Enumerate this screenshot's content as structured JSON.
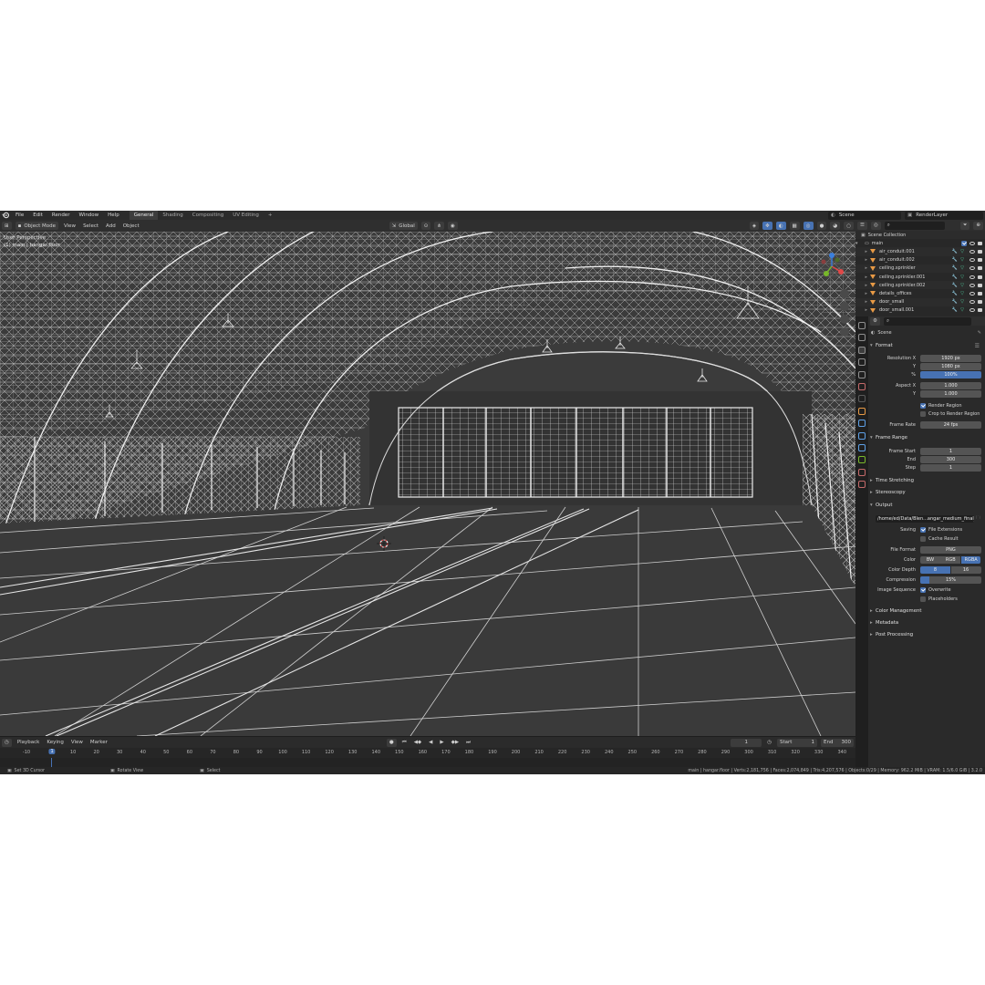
{
  "menu": {
    "items": [
      "File",
      "Edit",
      "Render",
      "Window",
      "Help"
    ],
    "workspaces": [
      "General",
      "Shading",
      "Compositing",
      "UV Editing"
    ],
    "active_workspace": "General",
    "add_tab": "+",
    "scene": "Scene",
    "view_layer": "RenderLayer"
  },
  "viewport_header": {
    "mode": "Object Mode",
    "view": "View",
    "select": "Select",
    "add": "Add",
    "object": "Object",
    "orientation": "Global"
  },
  "viewport": {
    "perspective_label": "User Perspective",
    "collection_label": "(1) main | hangar.floor"
  },
  "outliner": {
    "root": "Scene Collection",
    "collection": "main",
    "items": [
      "air_conduit.001",
      "air_conduit.002",
      "ceiling.sprinkler",
      "ceiling.sprinkler.001",
      "ceiling.sprinkler.002",
      "details_offices",
      "door_small",
      "door_small.001"
    ]
  },
  "properties": {
    "header": "Scene",
    "format": {
      "title": "Format",
      "resolution_x_label": "Resolution X",
      "resolution_x": "1920 px",
      "y_label": "Y",
      "resolution_y": "1080 px",
      "pct_label": "%",
      "percentage": "100%",
      "aspect_x_label": "Aspect X",
      "aspect_x": "1.000",
      "aspect_y_label": "Y",
      "aspect_y": "1.000",
      "render_region": "Render Region",
      "crop": "Crop to Render Region",
      "frame_rate_label": "Frame Rate",
      "frame_rate": "24 fps"
    },
    "frame_range": {
      "title": "Frame Range",
      "start_label": "Frame Start",
      "start": "1",
      "end_label": "End",
      "end": "300",
      "step_label": "Step",
      "step": "1"
    },
    "time_stretching": "Time Stretching",
    "stereoscopy": "Stereoscopy",
    "output": {
      "title": "Output",
      "path": "/home/ed/Data/Blen...angar_medium_final_",
      "saving_label": "Saving",
      "file_extensions": "File Extensions",
      "cache_result": "Cache Result",
      "file_format_label": "File Format",
      "file_format": "PNG",
      "color_label": "Color",
      "color_options": [
        "BW",
        "RGB",
        "RGBA"
      ],
      "color_selected": "RGBA",
      "color_depth_label": "Color Depth",
      "color_depth_options": [
        "8",
        "16"
      ],
      "color_depth_selected": "8",
      "compression_label": "Compression",
      "compression": "15%",
      "compression_value": 0.15,
      "image_sequence_label": "Image Sequence",
      "overwrite": "Overwrite",
      "placeholders": "Placeholders"
    },
    "color_management": "Color Management",
    "metadata": "Metadata",
    "post_processing": "Post Processing"
  },
  "timeline": {
    "playback": "Playback",
    "keying": "Keying",
    "view": "View",
    "marker": "Marker",
    "current_frame": "1",
    "start_label": "Start",
    "start": "1",
    "end_label": "End",
    "end": "300",
    "ticks": [
      "-10",
      "1",
      "10",
      "20",
      "30",
      "40",
      "50",
      "60",
      "70",
      "80",
      "90",
      "100",
      "110",
      "120",
      "130",
      "140",
      "150",
      "160",
      "170",
      "180",
      "190",
      "200",
      "210",
      "220",
      "230",
      "240",
      "250",
      "260",
      "270",
      "280",
      "290",
      "300",
      "310",
      "320",
      "330",
      "340"
    ]
  },
  "status": {
    "left1": "Set 3D Cursor",
    "left2": "Rotate View",
    "left3": "Select",
    "stats": "main | hangar.floor | Verts:2,181,756 | Faces:2,074,849 | Tris:4,207,576 | Objects:0/29 | Memory: 962.2 MiB | VRAM: 1.5/6.0 GiB | 3.2.0"
  },
  "colors": {
    "accent": "#4772b3",
    "ui_bg": "#2a2a2a",
    "viewport_bg": "#3b3b3b",
    "wire": "#d8d8d8",
    "mesh_icon": "#e89a45",
    "data_icon": "#4fd1a0"
  }
}
